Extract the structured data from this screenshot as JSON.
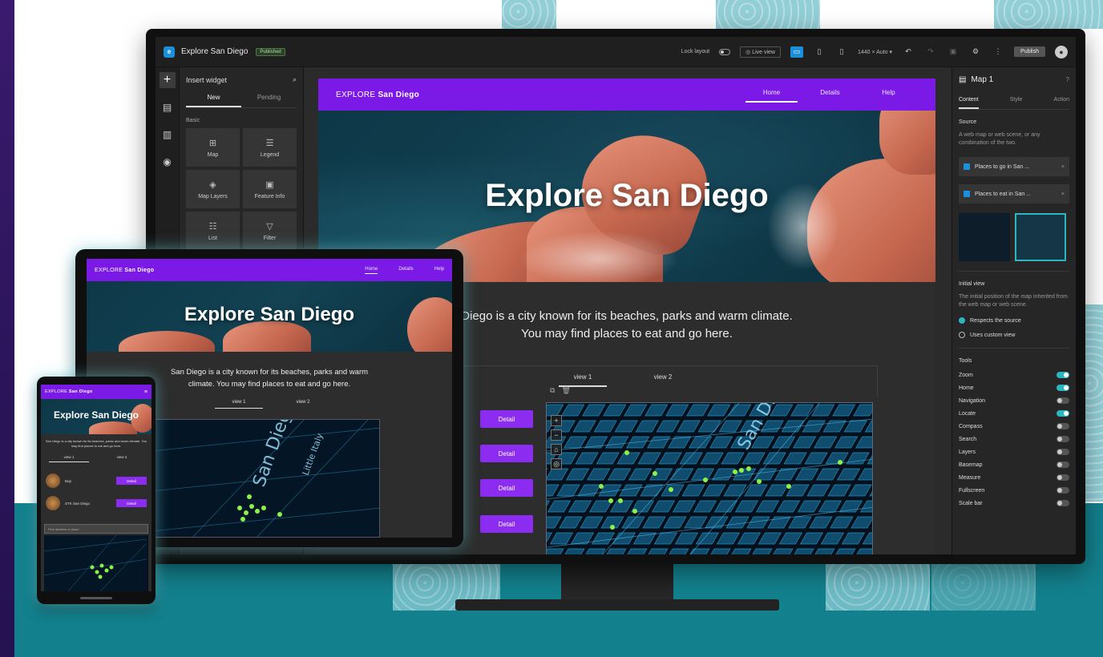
{
  "colors": {
    "brand_purple": "#7b1ae6",
    "button_purple": "#8b2cf0",
    "accent_blue": "#1b8fd8",
    "accent_teal": "#2db5c0",
    "background_teal": "#13808d"
  },
  "builder": {
    "app_title": "Explore San Diego",
    "status_badge": "Published",
    "header": {
      "lock_layout_label": "Lock layout",
      "live_view_label": "Live view",
      "resolution_label": "1440 × Auto",
      "publish_label": "Publish"
    },
    "insert_panel": {
      "title": "Insert widget",
      "tabs": [
        "New",
        "Pending"
      ],
      "section": "Basic",
      "widgets": [
        {
          "label": "Map",
          "icon": "map-icon"
        },
        {
          "label": "Legend",
          "icon": "legend-icon"
        },
        {
          "label": "Map Layers",
          "icon": "layers-icon"
        },
        {
          "label": "Feature Info",
          "icon": "feature-info-icon"
        },
        {
          "label": "List",
          "icon": "list-icon"
        },
        {
          "label": "Filter",
          "icon": "filter-icon"
        }
      ]
    },
    "settings_panel": {
      "title": "Map 1",
      "tabs": [
        "Content",
        "Style",
        "Action"
      ],
      "source_label": "Source",
      "source_help": "A web map or web scene, or any combination of the two.",
      "sources": [
        "Places to go in San ...",
        "Places to eat in San ..."
      ],
      "initial_view_label": "Initial view",
      "initial_view_help": "The initial position of the map inherited from the web map or web scene.",
      "view_options": [
        {
          "label": "Respects the source",
          "selected": true
        },
        {
          "label": "Uses custom view",
          "selected": false
        }
      ],
      "tools_label": "Tools",
      "tools": [
        {
          "label": "Zoom",
          "on": true
        },
        {
          "label": "Home",
          "on": true
        },
        {
          "label": "Navigation",
          "on": false
        },
        {
          "label": "Locate",
          "on": true
        },
        {
          "label": "Compass",
          "on": false
        },
        {
          "label": "Search",
          "on": false
        },
        {
          "label": "Layers",
          "on": false
        },
        {
          "label": "Basemap",
          "on": false
        },
        {
          "label": "Measure",
          "on": false
        },
        {
          "label": "Fullscreen",
          "on": false
        },
        {
          "label": "Scale bar",
          "on": false
        }
      ]
    }
  },
  "site": {
    "brand_prefix": "EXPLORE",
    "brand_name": "San Diego",
    "nav_links": [
      "Home",
      "Details",
      "Help"
    ],
    "hero_title": "Explore San Diego",
    "description_line1": "San Diego is a city known for its beaches, parks and warm climate.",
    "description_line2": "You may find places to eat and go here.",
    "desktop_description_line1": "Diego is a city known for its beaches, parks and warm climate.",
    "tablet_description_line1": "San Diego is a city known for its beaches, parks and warm",
    "tablet_description_line2": "climate. You may find places to eat and go here.",
    "view_tabs": [
      "view 1",
      "view 2"
    ],
    "detail_label": "Detail",
    "map_street_labels": [
      "San Diego",
      "Little Italy"
    ]
  },
  "phone": {
    "description": "San Diego is a city known for its beaches, parks and warm climate. You may find places to eat and go here.",
    "list": [
      {
        "name": "Bop"
      },
      {
        "name": "STK San Diego"
      }
    ],
    "search_placeholder": "Find address or place"
  }
}
